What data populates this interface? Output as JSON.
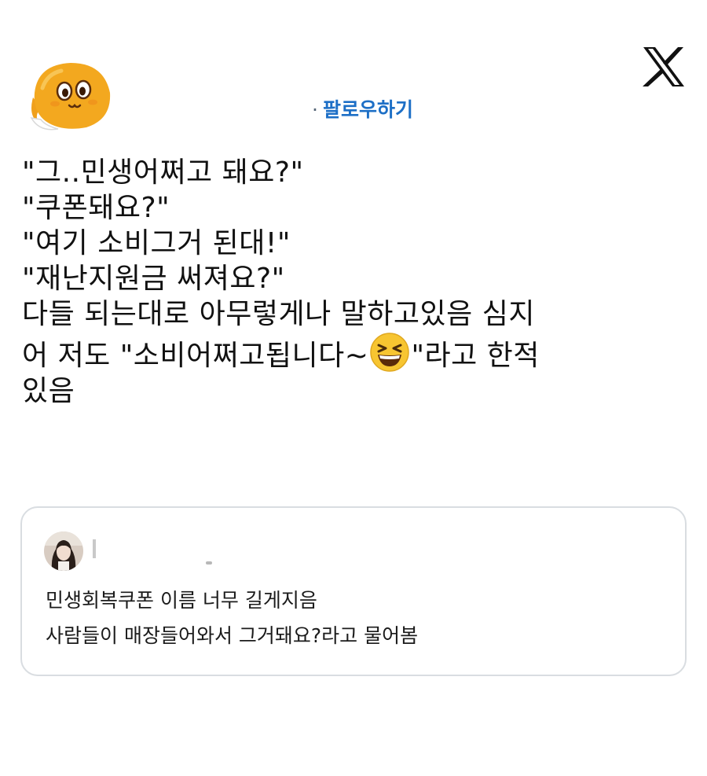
{
  "header": {
    "follow_label": "팔로우하기",
    "separator": "·"
  },
  "icons": {
    "logo": "x-logo-icon",
    "author_avatar": "cartoon-mascot-avatar",
    "quoted_avatar": "user-photo-avatar",
    "emoji": "grinning-squinting-face"
  },
  "post": {
    "lines": [
      "\"그..민생어쩌고 돼요?\"",
      "\"쿠폰돼요?\"",
      "\"여기 소비그거 된대!\"",
      "\"재난지원금 써져요?\"",
      "다들 되는대로 아무렇게나 말하고있음 심지"
    ],
    "line6_before": "어 저도 \"소비어쩌고됩니다~",
    "line6_after": "\"라고 한적",
    "line7": "있음"
  },
  "quoted": {
    "lines": [
      "민생회복쿠폰 이름 너무 길게지음",
      "사람들이 매장들어와서 그거돼요?라고 물어봄"
    ]
  },
  "colors": {
    "follow": "#1d6fc6",
    "text": "#111111",
    "border": "#d9dde1",
    "avatar_fill": "#f3a81f",
    "emoji_fill": "#f7c531"
  }
}
